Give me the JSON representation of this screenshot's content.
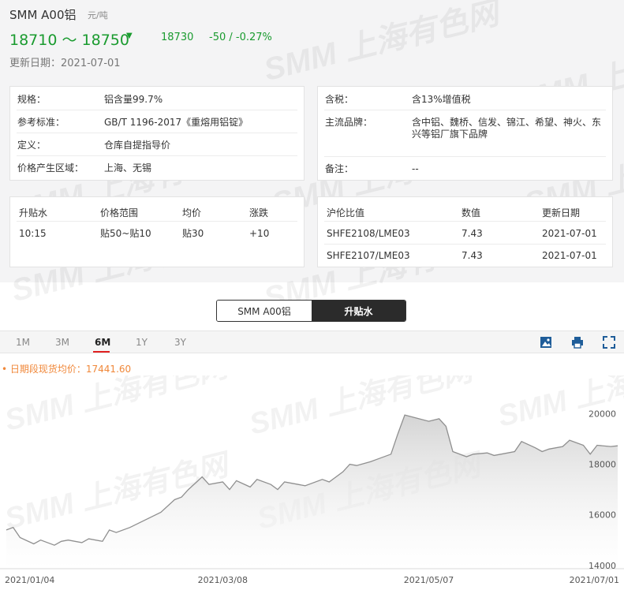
{
  "header": {
    "name": "SMM A00铝",
    "unit": "元/吨",
    "price_range": "18710 ～ 18750",
    "avg_price": "18730",
    "change": "-50  /  -0.27%",
    "update_date": "更新日期：2021-07-01",
    "colors": {
      "down": "#1a9b2f",
      "accent": "#e02020",
      "avg_line": "#f0883a"
    }
  },
  "watermark": "SMM 上海有色网",
  "spec_card": [
    {
      "label": "规格：",
      "value": "铝含量99.7%"
    },
    {
      "label": "参考标准：",
      "value": "GB/T 1196-2017《重熔用铝锭》"
    },
    {
      "label": "定义：",
      "value": "仓库自提指导价"
    },
    {
      "label": "价格产生区域：",
      "value": "上海、无锡"
    }
  ],
  "tax_card": [
    {
      "label": "含税：",
      "value": "含13%增值税"
    },
    {
      "label": "主流品牌：",
      "value_line1": "含中铝、魏桥、信发、锦江、希望、神火、东",
      "value_line2": "兴等铝厂旗下品牌"
    },
    {
      "label": "备注：",
      "value": "--"
    }
  ],
  "premium_table": {
    "headers": [
      "升贴水",
      "价格范围",
      "均价",
      "涨跌"
    ],
    "rows": [
      [
        "10:15",
        "贴50~贴10",
        "贴30",
        "+10"
      ]
    ]
  },
  "ratio_table": {
    "headers": [
      "沪伦比值",
      "数值",
      "更新日期"
    ],
    "rows": [
      [
        "SHFE2108/LME03",
        "7.43",
        "2021-07-01"
      ],
      [
        "SHFE2107/LME03",
        "7.43",
        "2021-07-01"
      ]
    ]
  },
  "tabs": [
    "SMM A00铝",
    "升贴水"
  ],
  "ranges": [
    "1M",
    "3M",
    "6M",
    "1Y",
    "3Y"
  ],
  "active_range": "6M",
  "toolbar_icons": [
    "image-download-icon",
    "print-icon",
    "fullscreen-icon"
  ],
  "avg_legend": "• 日期段现货均价：17441.60",
  "chart_data": {
    "type": "area",
    "title": "",
    "xlabel": "",
    "ylabel": "",
    "x_ticks": [
      "2021/01/04",
      "2021/03/08",
      "2021/05/07",
      "2021/07/01"
    ],
    "y_ticks": [
      "14000",
      "16000",
      "18000",
      "20000"
    ],
    "ylim": [
      13900,
      21200
    ],
    "grid": false,
    "average": 17441.6,
    "color": "#c9c9c9",
    "dates": [
      "2021-01-04",
      "2021-01-06",
      "2021-01-08",
      "2021-01-12",
      "2021-01-14",
      "2021-01-18",
      "2021-01-20",
      "2021-01-22",
      "2021-01-26",
      "2021-01-28",
      "2021-02-01",
      "2021-02-03",
      "2021-02-05",
      "2021-02-09",
      "2021-02-18",
      "2021-02-22",
      "2021-02-24",
      "2021-02-26",
      "2021-03-02",
      "2021-03-04",
      "2021-03-08",
      "2021-03-10",
      "2021-03-12",
      "2021-03-16",
      "2021-03-18",
      "2021-03-22",
      "2021-03-24",
      "2021-03-26",
      "2021-03-30",
      "2021-04-01",
      "2021-04-06",
      "2021-04-08",
      "2021-04-12",
      "2021-04-14",
      "2021-04-16",
      "2021-04-20",
      "2021-04-22",
      "2021-04-26",
      "2021-04-28",
      "2021-04-30",
      "2021-05-07",
      "2021-05-10",
      "2021-05-12",
      "2021-05-14",
      "2021-05-18",
      "2021-05-20",
      "2021-05-24",
      "2021-05-26",
      "2021-05-28",
      "2021-06-01",
      "2021-06-03",
      "2021-06-07",
      "2021-06-09",
      "2021-06-11",
      "2021-06-15",
      "2021-06-17",
      "2021-06-21",
      "2021-06-23",
      "2021-06-25",
      "2021-06-29",
      "2021-07-01"
    ],
    "values": [
      15400,
      15500,
      15100,
      14850,
      15000,
      14800,
      14950,
      15000,
      14900,
      15050,
      14950,
      15400,
      15300,
      15500,
      16100,
      16600,
      16700,
      17000,
      17500,
      17200,
      17300,
      17000,
      17350,
      17100,
      17400,
      17200,
      17000,
      17300,
      17200,
      17150,
      17400,
      17300,
      17700,
      18000,
      17950,
      18100,
      18200,
      18400,
      19200,
      19950,
      19700,
      19800,
      19500,
      18500,
      18300,
      18400,
      18450,
      18350,
      18400,
      18500,
      18900,
      18650,
      18500,
      18600,
      18700,
      18950,
      18750,
      18400,
      18750,
      18700,
      18730
    ]
  }
}
